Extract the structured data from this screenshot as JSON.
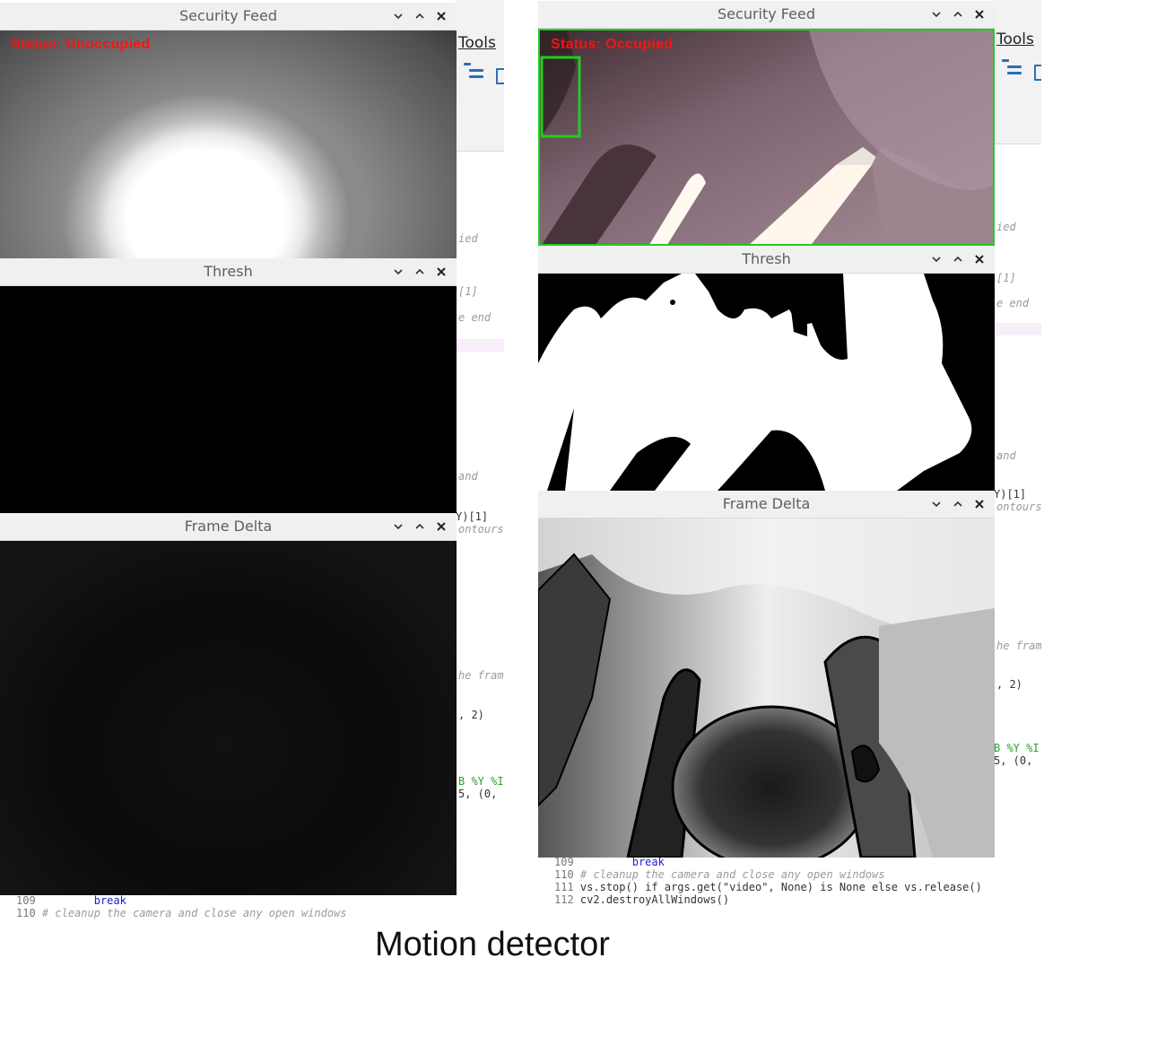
{
  "caption": "Motion detector",
  "left": {
    "ide": {
      "menu_tools": "Tools",
      "fragments": [
        "ied",
        "[1]",
        "e end",
        "and",
        "Y)[1]",
        "ontours",
        "he fram",
        ", 2)",
        "B %Y %I",
        "5, (0,"
      ],
      "code_lines": [
        {
          "num": "109",
          "code": "        break"
        },
        {
          "num": "110",
          "code": "# cleanup the camera and close any open windows"
        }
      ]
    },
    "windows": [
      {
        "title": "Security Feed",
        "status": "Status: Unoccupied"
      },
      {
        "title": "Thresh"
      },
      {
        "title": "Frame Delta"
      }
    ]
  },
  "right": {
    "ide": {
      "menu_tools": "Tools",
      "fragments": [
        "ied",
        "[1]",
        "e end",
        "and",
        "Y)[1]",
        "ontours",
        "he fram",
        ", 2)",
        "B %Y %I",
        "5, (0,"
      ],
      "code_lines": [
        {
          "num": "109",
          "code": "        break"
        },
        {
          "num": "110",
          "code": "# cleanup the camera and close any open windows"
        },
        {
          "num": "111",
          "code": "vs.stop() if args.get(\"video\", None) is None else vs.release()"
        },
        {
          "num": "112",
          "code": "cv2.destroyAllWindows()"
        }
      ]
    },
    "windows": [
      {
        "title": "Security Feed",
        "status": "Status: Occupied"
      },
      {
        "title": "Thresh"
      },
      {
        "title": "Frame Delta"
      }
    ]
  },
  "colors": {
    "status_text": "#ff1111",
    "motion_box": "#22cc22",
    "titlebar": "#f0f0f0",
    "title_text": "#5f5f5f"
  },
  "icons": [
    "chevron-down-icon",
    "chevron-up-icon",
    "close-icon"
  ]
}
